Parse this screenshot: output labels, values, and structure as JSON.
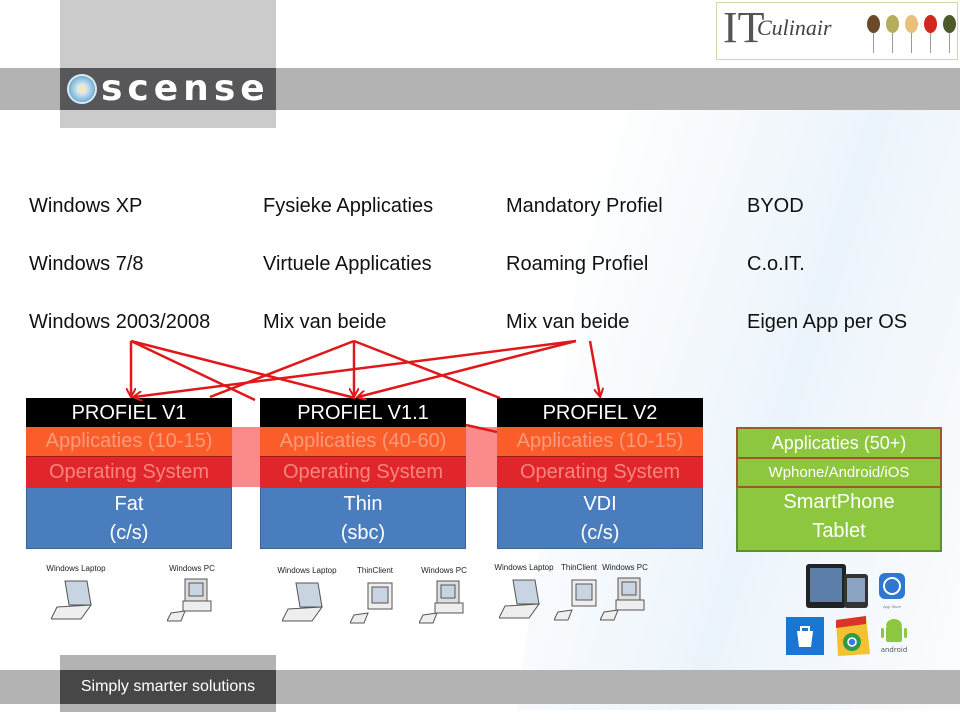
{
  "header": {
    "logo_text": "scense",
    "partner_logo": {
      "brand": "IT Culinair",
      "it": "IT",
      "culinair": "Culinair"
    }
  },
  "columns": [
    {
      "items": [
        "Windows XP",
        "Windows 7/8",
        "Windows 2003/2008"
      ]
    },
    {
      "items": [
        "Fysieke Applicaties",
        "Virtuele Applicaties",
        "Mix van beide"
      ]
    },
    {
      "items": [
        "Mandatory Profiel",
        "Roaming Profiel",
        "Mix van beide"
      ]
    },
    {
      "items": [
        "BYOD",
        "C.o.IT.",
        "Eigen App per OS"
      ]
    }
  ],
  "profiles": [
    {
      "title": "PROFIEL V1",
      "apps": "Applicaties (10-15)",
      "os": "Operating System",
      "base_line1": "Fat",
      "base_line2": "(c/s)",
      "devices": [
        "Windows Laptop",
        "Windows PC"
      ]
    },
    {
      "title": "PROFIEL V1.1",
      "apps": "Applicaties (40-60)",
      "os": "Operating System",
      "base_line1": "Thin",
      "base_line2": "(sbc)",
      "devices": [
        "Windows Laptop",
        "ThinClient",
        "Windows PC"
      ]
    },
    {
      "title": "PROFIEL V2",
      "apps": "Applicaties (10-15)",
      "os": "Operating System",
      "base_line1": "VDI",
      "base_line2": "(c/s)",
      "devices": [
        "Windows Laptop",
        "ThinClient",
        "Windows PC"
      ]
    }
  ],
  "mobile_stack": {
    "apps": "Applicaties (50+)",
    "os": "Wphone/Android/iOS",
    "base_line1": "SmartPhone",
    "base_line2": "Tablet",
    "store_icons": [
      "ipad-iphone",
      "app-store",
      "windows-store",
      "chrome-web-store",
      "android"
    ],
    "app_store_caption": "App Store",
    "android_caption": "android"
  },
  "colors": {
    "header": "#000000",
    "apps": "#fa5d2a",
    "os": "#e1262b",
    "base": "#4a7dbd",
    "mobile": "#8dc63f",
    "arrows": "#e0181b"
  },
  "footer": {
    "tagline": "Simply smarter solutions"
  }
}
